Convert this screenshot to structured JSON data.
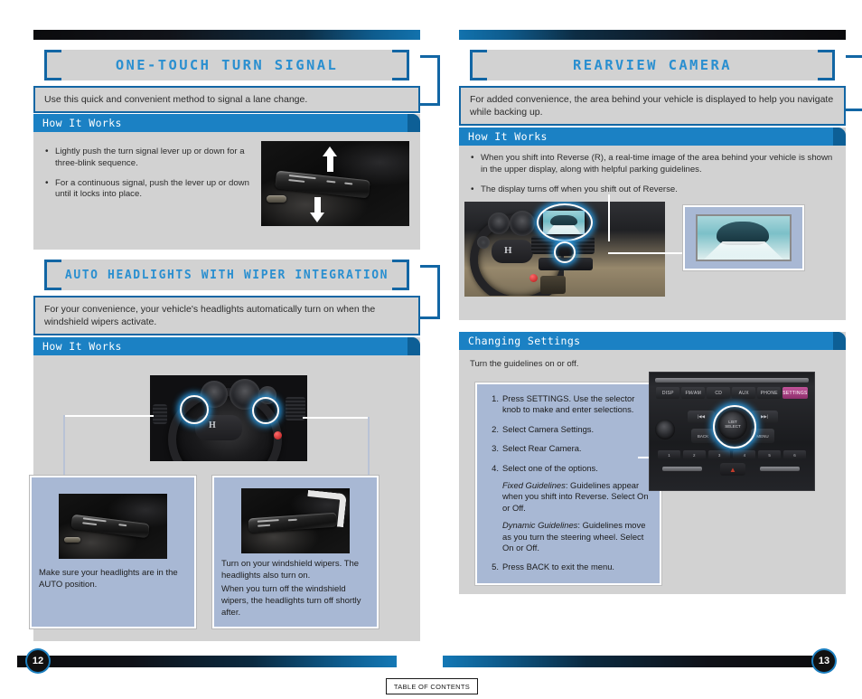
{
  "document": {
    "page_left": "12",
    "page_right": "13",
    "toc_button": "TABLE OF CONTENTS"
  },
  "left_column": {
    "sections": [
      {
        "title": "ONE-TOUCH TURN SIGNAL",
        "description": "Use this quick and convenient method to signal a lane change.",
        "panel_header": "How It Works",
        "bullets": [
          "Lightly push the turn signal lever up or down for a three-blink sequence.",
          "For a continuous signal, push the lever up or down until it locks into place."
        ],
        "image_name": "turn-signal-lever-photo"
      },
      {
        "title": "AUTO HEADLIGHTS WITH WIPER INTEGRATION",
        "description": "For your convenience, your vehicle's headlights automatically turn on when the windshield wipers activate.",
        "panel_header": "How It Works",
        "image_name": "steering-wheel-stalks-photo",
        "callouts": [
          {
            "image_name": "headlight-stalk-photo",
            "text": "Make sure your headlights are in the AUTO position."
          },
          {
            "image_name": "wiper-stalk-photo",
            "text_1": "Turn on your windshield wipers. The headlights also turn on.",
            "text_2": "When you turn off the windshield wipers, the headlights turn off shortly after."
          }
        ]
      }
    ]
  },
  "right_column": {
    "sections": [
      {
        "title": "REARVIEW CAMERA",
        "description": "For added convenience, the area behind your vehicle is displayed to help you navigate while backing up.",
        "panel_header": "How It Works",
        "bullets": [
          "When you shift into Reverse (R), a real-time image of the area behind your vehicle is shown in the upper display, along with helpful parking guidelines.",
          "The display turns off when you shift out of Reverse."
        ],
        "image_name": "dashboard-upper-display-photo",
        "inset_name": "rearview-camera-image-inset"
      },
      {
        "title": "",
        "panel_header": "Changing Settings",
        "intro": "Turn the guidelines on or off.",
        "steps": [
          {
            "text": "Press SETTINGS. Use the selector knob to make and enter selections."
          },
          {
            "text": "Select Camera Settings."
          },
          {
            "text": "Select Rear Camera."
          },
          {
            "text": "Select one of the options.",
            "sub": [
              {
                "label": "Fixed Guidelines",
                "body": ": Guidelines appear when you shift into Reverse. Select On or Off."
              },
              {
                "label": "Dynamic Guidelines",
                "body": ": Guidelines move as you turn the steering wheel. Select On or Off."
              }
            ]
          },
          {
            "text": "Press BACK to exit the menu."
          }
        ],
        "image_name": "audio-control-panel-photo",
        "audio_buttons": [
          "DISP",
          "FM/AM",
          "CD",
          "AUX",
          "PHONE",
          "SETTINGS"
        ],
        "knob_label": "LIST\nSELECT",
        "key_labels": {
          "prev": "|◀◀",
          "next": "▶▶|",
          "back": "BACK",
          "menu": "MENU"
        },
        "preset_numbers": [
          "1",
          "2",
          "3",
          "4",
          "5",
          "6"
        ]
      }
    ]
  },
  "colors": {
    "accent_blue": "#1b81c4",
    "title_blue": "#2a8fd0",
    "frame_blue": "#1266a4",
    "panel_gray": "#d2d2d2",
    "callout_blue": "#a8b8d4"
  }
}
